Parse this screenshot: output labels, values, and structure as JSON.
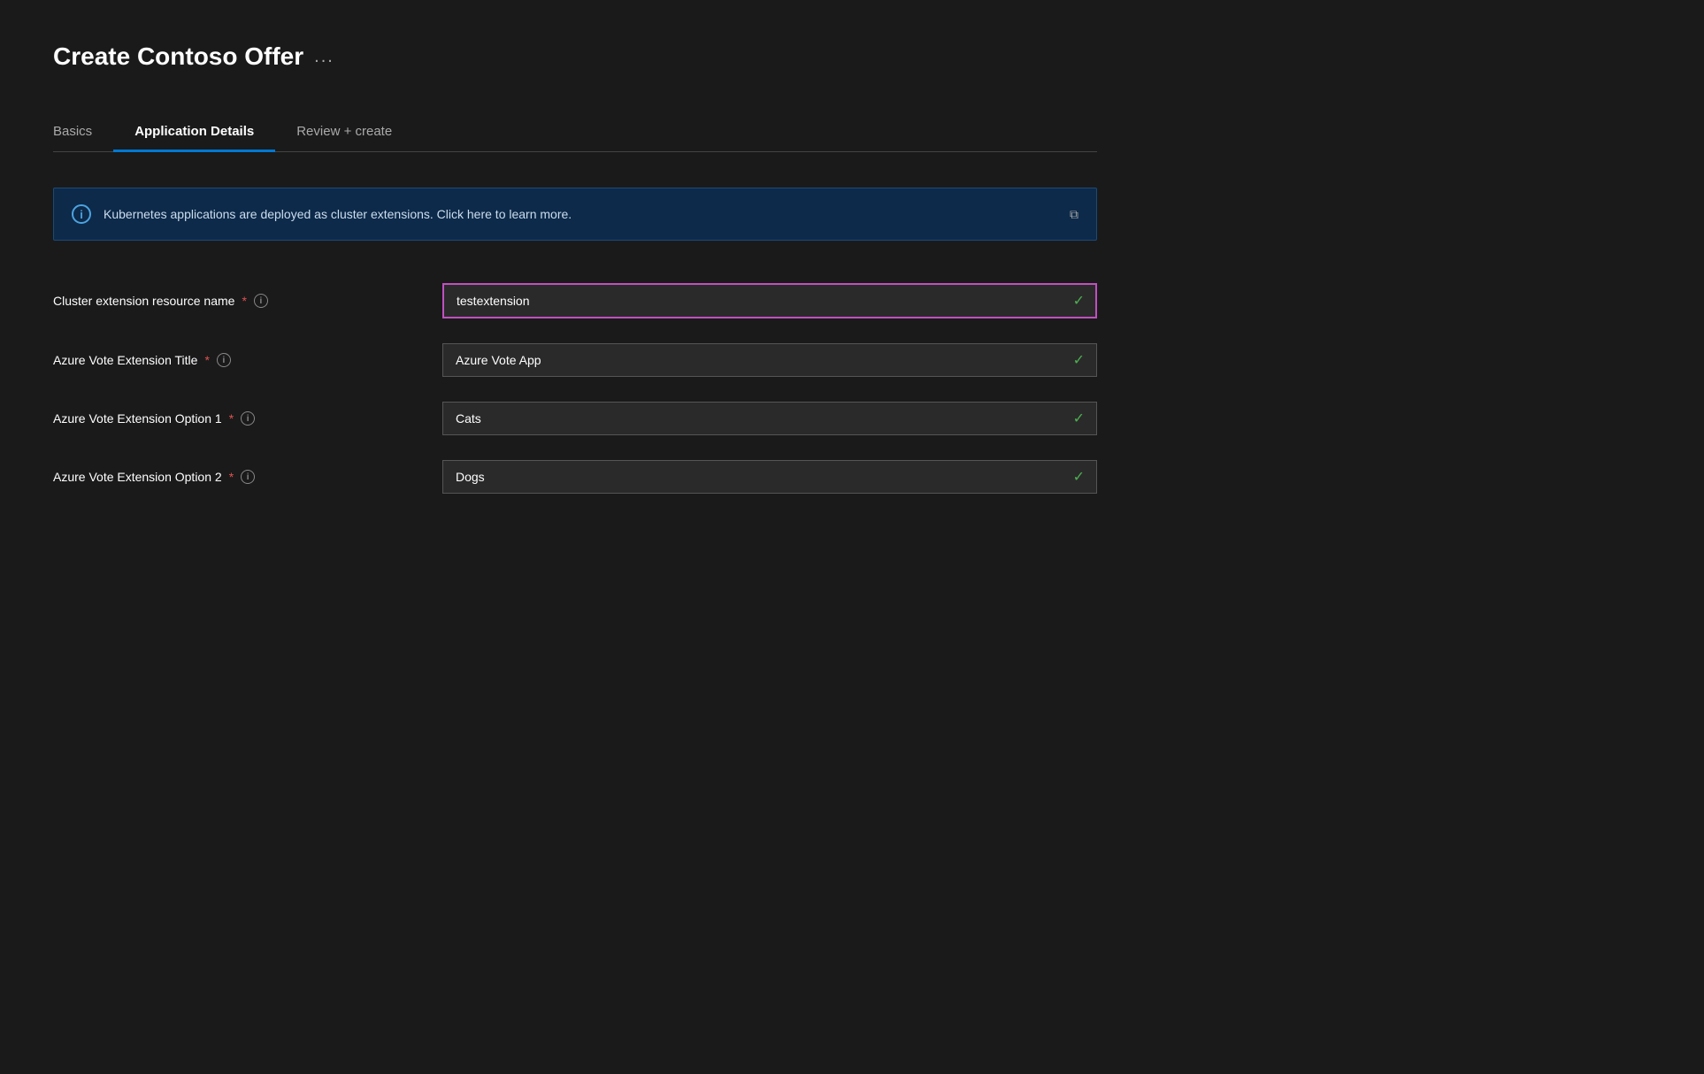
{
  "page": {
    "title": "Create  Contoso Offer",
    "title_ellipsis": "..."
  },
  "tabs": [
    {
      "id": "basics",
      "label": "Basics",
      "active": false
    },
    {
      "id": "application-details",
      "label": "Application Details",
      "active": true
    },
    {
      "id": "review-create",
      "label": "Review + create",
      "active": false
    }
  ],
  "info_banner": {
    "text": "Kubernetes applications are deployed as cluster extensions. Click here to learn more.",
    "icon_label": "i"
  },
  "form": {
    "fields": [
      {
        "id": "cluster-extension-resource-name",
        "label": "Cluster extension resource name",
        "required": true,
        "value": "testextension",
        "active": true,
        "valid": true
      },
      {
        "id": "azure-vote-extension-title",
        "label": "Azure Vote Extension Title",
        "required": true,
        "value": "Azure Vote App",
        "active": false,
        "valid": true
      },
      {
        "id": "azure-vote-extension-option-1",
        "label": "Azure Vote Extension Option 1",
        "required": true,
        "value": "Cats",
        "active": false,
        "valid": true
      },
      {
        "id": "azure-vote-extension-option-2",
        "label": "Azure Vote Extension Option 2",
        "required": true,
        "value": "Dogs",
        "active": false,
        "valid": true
      }
    ]
  },
  "icons": {
    "checkmark": "✓",
    "info_circle_label": "i",
    "expand": "⧉"
  }
}
